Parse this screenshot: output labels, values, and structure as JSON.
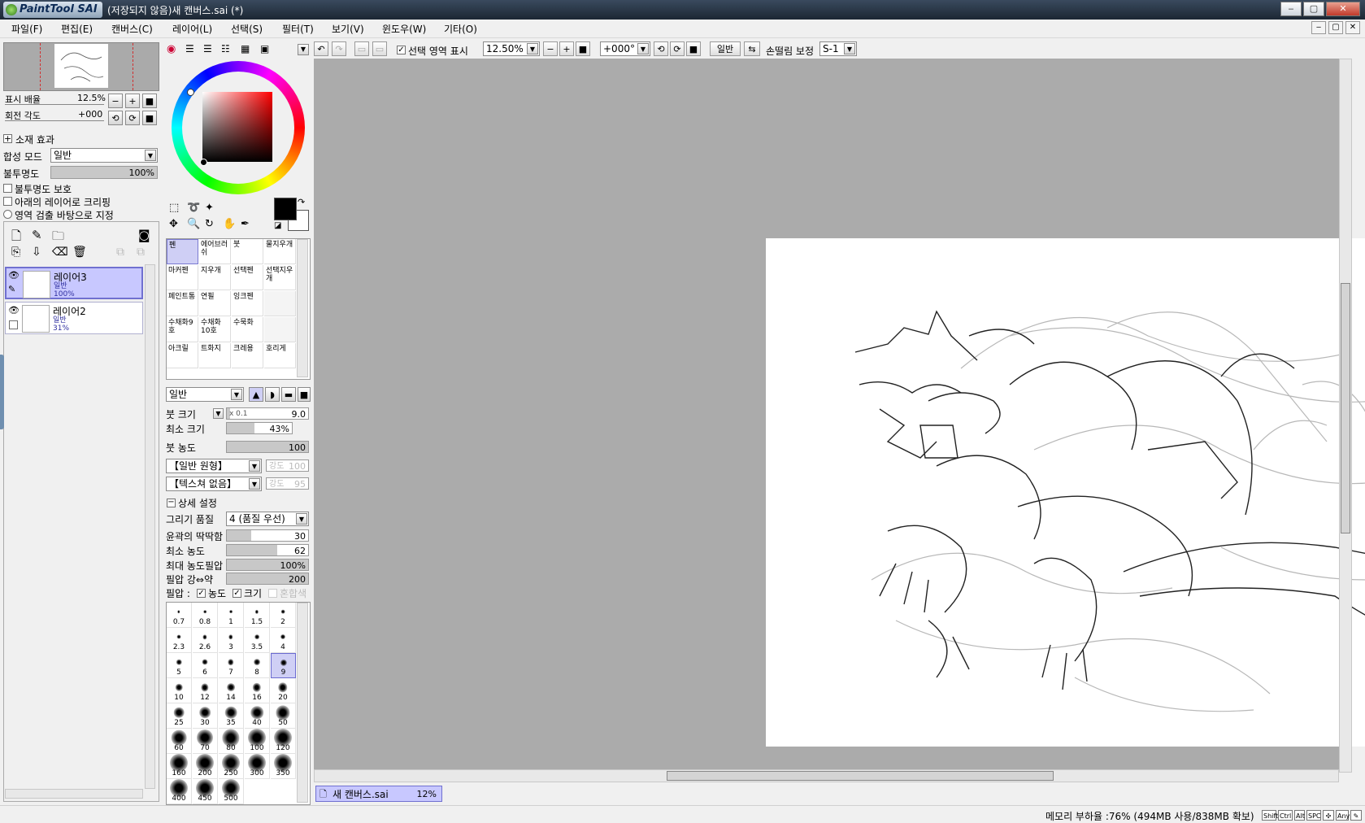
{
  "app": {
    "logo_text": "PaintTool SAI",
    "window_title": "(저장되지 않음)새 캔버스.sai (*)"
  },
  "window_buttons": {
    "minimize": "‒",
    "maximize": "▢",
    "close": "✕"
  },
  "menu": [
    "파일(F)",
    "편집(E)",
    "캔버스(C)",
    "레이어(L)",
    "선택(S)",
    "필터(T)",
    "보기(V)",
    "윈도우(W)",
    "기타(O)"
  ],
  "toolbar": {
    "show_selection_label": "선택 영역 표시",
    "zoom_value": "12.50%",
    "rotation_value": "+000°",
    "mode_button": "일반",
    "stabilizer_label": "손떨림 보정",
    "stabilizer_value": "S-1"
  },
  "navigator": {
    "zoom_label": "표시 배율",
    "zoom_value": "12.5%",
    "rotation_label": "회전 각도",
    "rotation_value": "+000"
  },
  "layer_props": {
    "effects_label": "소재 효과",
    "blend_label": "합성 모드",
    "blend_value": "일반",
    "opacity_label": "불투명도",
    "opacity_value": "100%",
    "opacity_fraction": 1.0,
    "opts": [
      "불투명도 보호",
      "아래의 레이어로 크리핑",
      "영역 검출 바탕으로 지정"
    ]
  },
  "layers": [
    {
      "name": "레이어3",
      "mode": "일반",
      "opacity": "100%",
      "selected": true
    },
    {
      "name": "레이어2",
      "mode": "일반",
      "opacity": "31%",
      "selected": false
    }
  ],
  "tools": [
    [
      "펜",
      "에어브러쉬",
      "붓",
      "물지우개"
    ],
    [
      "마커펜",
      "지우개",
      "선택펜",
      "선택지우개"
    ],
    [
      "페인트통",
      "연필",
      "잉크펜",
      ""
    ],
    [
      "수채화9호",
      "수채화10호",
      "수묵화",
      ""
    ],
    [
      "아크릴",
      "트화지",
      "크레용",
      "호리게"
    ]
  ],
  "brush": {
    "mode_value": "일반",
    "size_label": "붓 크기",
    "size_mult": "x 0.1",
    "size_value": "9.0",
    "size_fraction": 0.04,
    "min_size_label": "최소 크기",
    "min_size_value": "43%",
    "min_size_fraction": 0.43,
    "density_label": "붓 농도",
    "density_value": "100",
    "density_fraction": 1.0,
    "shape_value": "【일반 원형】",
    "shape_strength_label": "강도",
    "shape_strength_value": "100",
    "texture_value": "【텍스쳐 없음】",
    "texture_strength_label": "강도",
    "texture_strength_value": "95",
    "advanced_label": "상세 설정",
    "quality_label": "그리기 품질",
    "quality_value": "4 (품질 우선)",
    "edge_label": "윤곽의 딱딱함",
    "edge_value": "30",
    "edge_fraction": 0.3,
    "min_density_label": "최소 농도",
    "min_density_value": "62",
    "min_density_fraction": 0.62,
    "max_pressure_label": "최대 농도필압",
    "max_pressure_value": "100%",
    "max_pressure_fraction": 1.0,
    "pressure_label": "필압 강⇔약",
    "pressure_value": "200",
    "pressure_fraction": 1.0,
    "pressure_row_label": "필압 :",
    "pressure_density": "농도",
    "pressure_size": "크기",
    "pressure_mix": "혼합색"
  },
  "brush_sizes": [
    "0.7",
    "0.8",
    "1",
    "1.5",
    "2",
    "2.3",
    "2.6",
    "3",
    "3.5",
    "4",
    "5",
    "6",
    "7",
    "8",
    "9",
    "10",
    "12",
    "14",
    "16",
    "20",
    "25",
    "30",
    "35",
    "40",
    "50",
    "60",
    "70",
    "80",
    "100",
    "120",
    "160",
    "200",
    "250",
    "300",
    "350",
    "400",
    "450",
    "500"
  ],
  "document_tab": {
    "name": "새 캔버스.sai",
    "zoom": "12%"
  },
  "status": {
    "memory": "메모리 부하율 :76% (494MB 사용/838MB 확보)",
    "keys": [
      "Shift",
      "Ctrl",
      "Alt",
      "SPC",
      "✣",
      "Any",
      "✎"
    ]
  },
  "colors": {
    "accent_selected": "#c8c8ff",
    "canvas_bg": "#ababab",
    "primary_color": "#000000"
  }
}
